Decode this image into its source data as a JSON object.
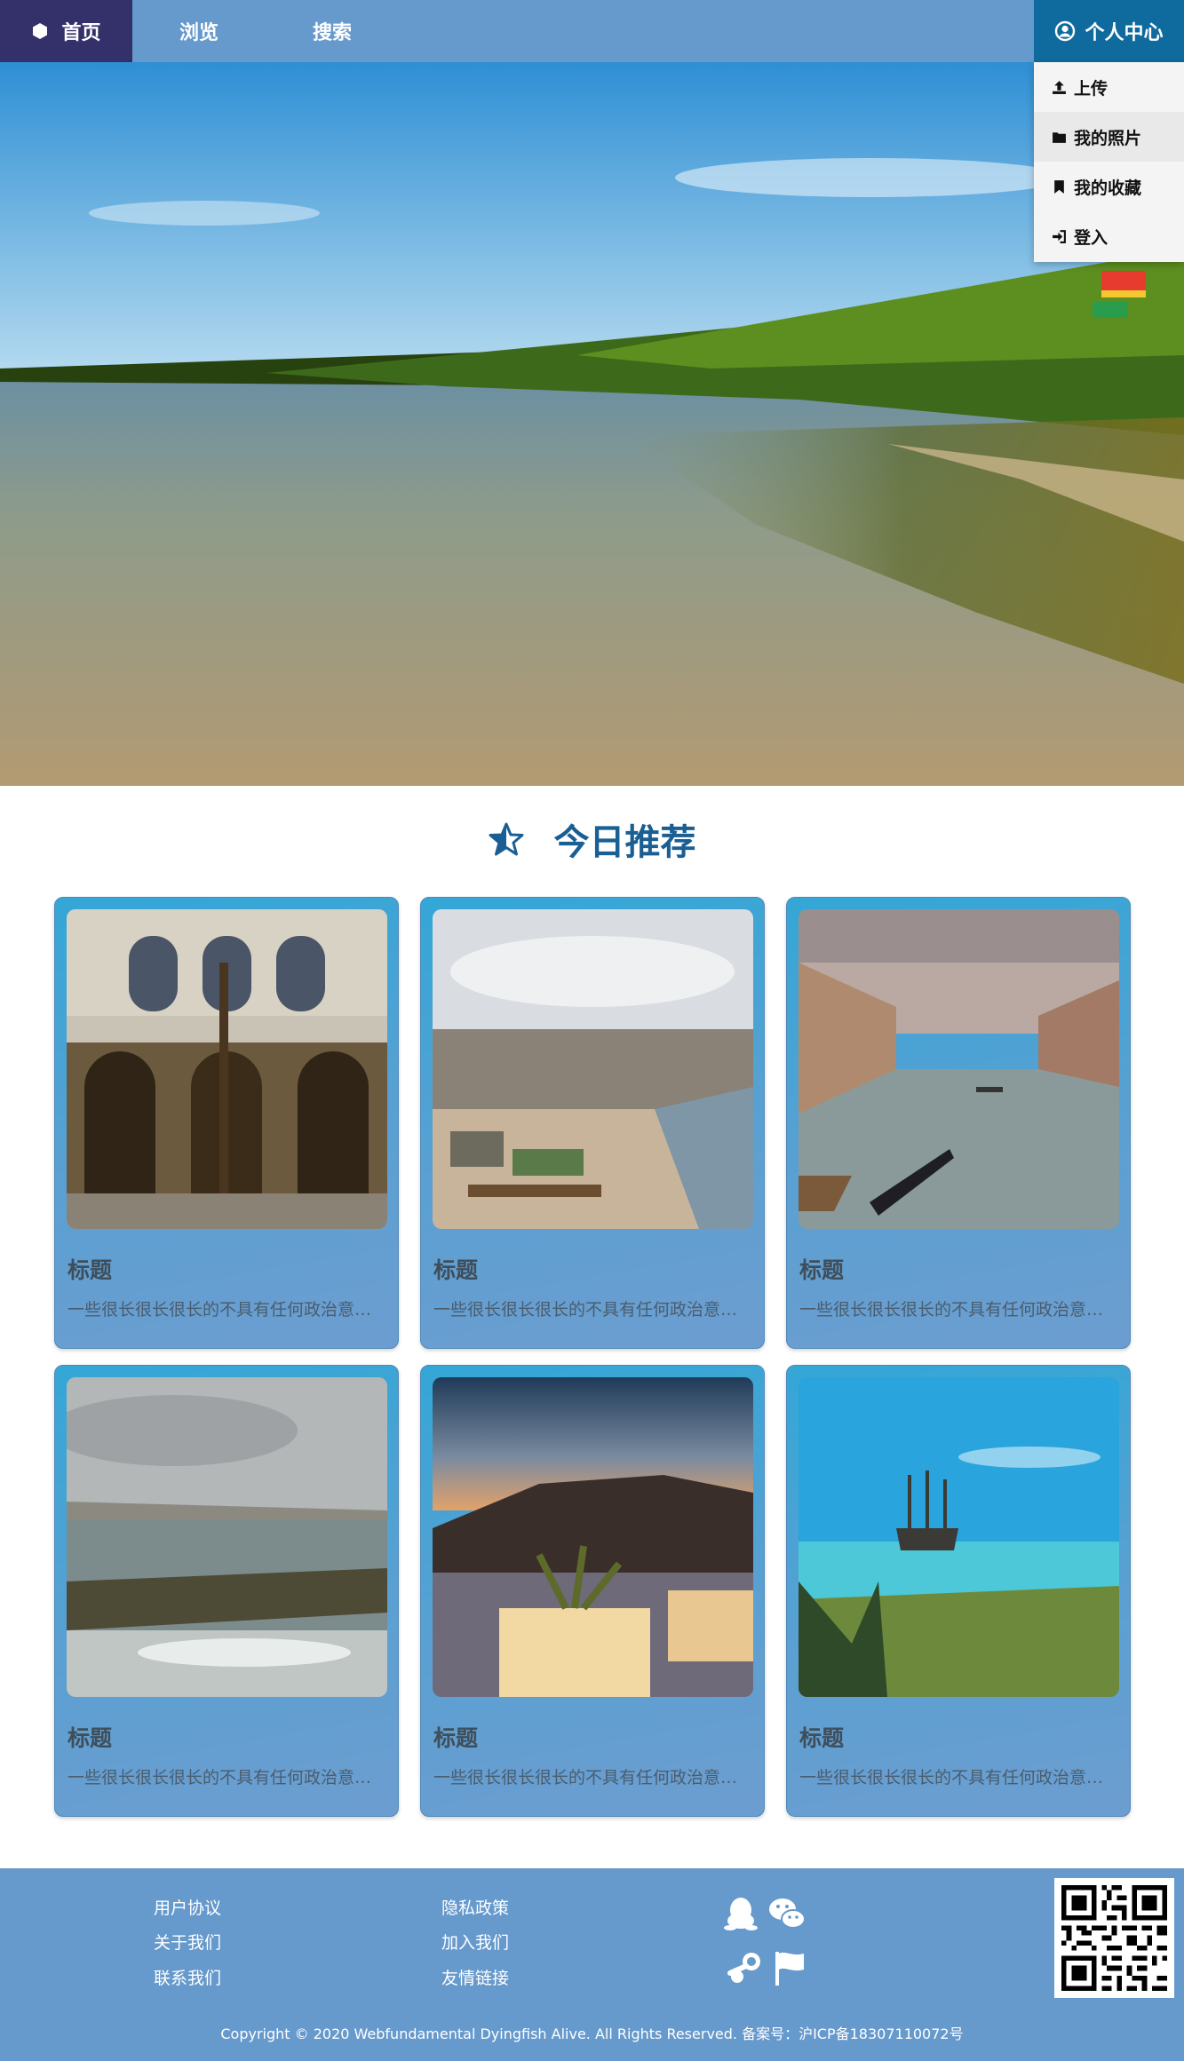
{
  "nav": {
    "home": "首页",
    "browse": "浏览",
    "search": "搜索",
    "user_center": "个人中心"
  },
  "dropdown": {
    "items": [
      {
        "label": "上传",
        "icon": "upload-icon"
      },
      {
        "label": "我的照片",
        "icon": "folder-icon"
      },
      {
        "label": "我的收藏",
        "icon": "bookmark-icon"
      },
      {
        "label": "登入",
        "icon": "sign-in-icon"
      }
    ]
  },
  "section": {
    "title": "今日推荐"
  },
  "cards": [
    {
      "title": "标题",
      "desc": "一些很长很长很长的不具有任何政治意义的文字描述"
    },
    {
      "title": "标题",
      "desc": "一些很长很长很长的不具有任何政治意义的文字描述"
    },
    {
      "title": "标题",
      "desc": "一些很长很长很长的不具有任何政治意义的文字描述"
    },
    {
      "title": "标题",
      "desc": "一些很长很长很长的不具有任何政治意义的文字描述"
    },
    {
      "title": "标题",
      "desc": "一些很长很长很长的不具有任何政治意义的文字描述"
    },
    {
      "title": "标题",
      "desc": "一些很长很长很长的不具有任何政治意义的文字描述"
    }
  ],
  "footer": {
    "col1": [
      "用户协议",
      "关于我们",
      "联系我们"
    ],
    "col2": [
      "隐私政策",
      "加入我们",
      "友情链接"
    ],
    "icons": [
      "qq-icon",
      "wechat-icon",
      "steam-icon",
      "flag-icon"
    ],
    "copyright": "Copyright © 2020 Webfundamental Dyingfish Alive. All Rights Reserved. 备案号：沪ICP备18307110072号"
  },
  "colors": {
    "nav_bg": "#6699cc",
    "nav_home_bg": "#33306a",
    "nav_user_bg": "#0f6b9e",
    "title_color": "#1a5f94",
    "footer_bg": "#6699cc"
  }
}
